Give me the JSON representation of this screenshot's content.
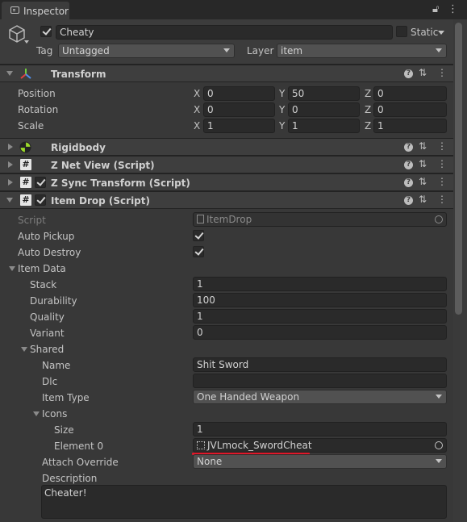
{
  "tab": {
    "label": "Inspector"
  },
  "header": {
    "object_name": "Cheaty",
    "static_label": "Static",
    "tag_label": "Tag",
    "tag_value": "Untagged",
    "layer_label": "Layer",
    "layer_value": "item"
  },
  "transform": {
    "title": "Transform",
    "rows": [
      {
        "label": "Position",
        "x": "0",
        "y": "50",
        "z": "0"
      },
      {
        "label": "Rotation",
        "x": "0",
        "y": "0",
        "z": "0"
      },
      {
        "label": "Scale",
        "x": "1",
        "y": "1",
        "z": "1"
      }
    ],
    "axis": {
      "x": "X",
      "y": "Y",
      "z": "Z"
    }
  },
  "components": {
    "rigidbody": "Rigidbody",
    "znetview": "Z Net View (Script)",
    "zsync": "Z Sync Transform (Script)",
    "itemdrop": "Item Drop (Script)"
  },
  "itemdrop": {
    "script_label": "Script",
    "script_value": "ItemDrop",
    "auto_pickup_label": "Auto Pickup",
    "auto_pickup": true,
    "auto_destroy_label": "Auto Destroy",
    "auto_destroy": true,
    "item_data_label": "Item Data",
    "stack_label": "Stack",
    "stack": "1",
    "durability_label": "Durability",
    "durability": "100",
    "quality_label": "Quality",
    "quality": "1",
    "variant_label": "Variant",
    "variant": "0",
    "shared_label": "Shared",
    "name_label": "Name",
    "name": "Shit Sword",
    "dlc_label": "Dlc",
    "dlc": "",
    "item_type_label": "Item Type",
    "item_type": "One Handed Weapon",
    "icons_label": "Icons",
    "size_label": "Size",
    "size": "1",
    "element0_label": "Element 0",
    "element0": "JVLmock_SwordCheat",
    "attach_override_label": "Attach Override",
    "attach_override": "None",
    "description_label": "Description",
    "description": "Cheater!"
  },
  "colors": {
    "highlight_underline": "#e0182a",
    "background": "#383838"
  }
}
